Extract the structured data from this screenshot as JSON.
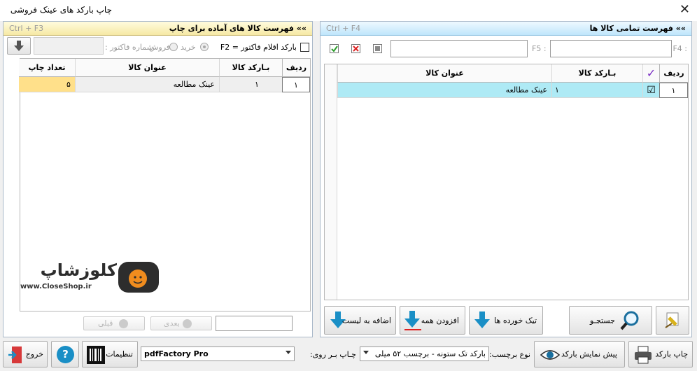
{
  "window": {
    "title": "چاپ بارکد های عینک فروشی",
    "close_glyph": "✕"
  },
  "right_panel": {
    "title": "»» فهرست تمامی کالا ها",
    "shortcut": "Ctrl + F4",
    "search_f5_label": ": F5",
    "search_f4_label": ": F4",
    "grid": {
      "headers": {
        "row": "ردیف",
        "check": "✓",
        "barcode": "بـارکد کالا",
        "name": "عنوان کالا"
      },
      "rows": [
        {
          "row": "۱",
          "checked": "☑",
          "barcode": "۱",
          "name": "عینک مطالعه"
        }
      ]
    },
    "buttons": {
      "search": "جستجـو",
      "single": "تیک خورده ها",
      "add_all": "افزودن همه",
      "add_list": "اضافه به لیست"
    }
  },
  "left_panel": {
    "title": "»» فهرست کالا های آماده برای چاپ",
    "shortcut": "Ctrl + F3",
    "invoice_checkbox_label": "بارکد اقلام فاکتور = F2",
    "radio_buy": "خرید",
    "radio_sell": "فروش",
    "invoice_number_label": "شماره فاکتور :",
    "grid": {
      "headers": {
        "row": "ردیف",
        "barcode": "بـارکد کالا",
        "name": "عنوان کالا",
        "count": "تعداد چاپ"
      },
      "rows": [
        {
          "row": "۱",
          "barcode": "۱",
          "name": "عینک مطالعه",
          "count": "۵"
        }
      ]
    },
    "nav": {
      "next": "بعدی",
      "prev": "قبلی"
    },
    "watermark": {
      "brand": "کلوزشاپ",
      "url": "www.CloseShop.ir"
    }
  },
  "bottom": {
    "print_barcode": "چاپ بارکد",
    "preview_barcode": "پیش نمایش بارکد",
    "label_type_label": "نوع برچسب:",
    "label_type_value": "بارکد تک ستونه - برچسب ۵۲ میلی",
    "print_on_label": "چـاپ بـر روی:",
    "printer_value": "pdfFactory Pro",
    "settings": "تنظیمات",
    "help": "?",
    "exit": "خروج"
  },
  "colors": {
    "selected_row": "#aeeaf5",
    "count_cell": "#ffe08a",
    "accent_blue": "#1a8fc6"
  }
}
